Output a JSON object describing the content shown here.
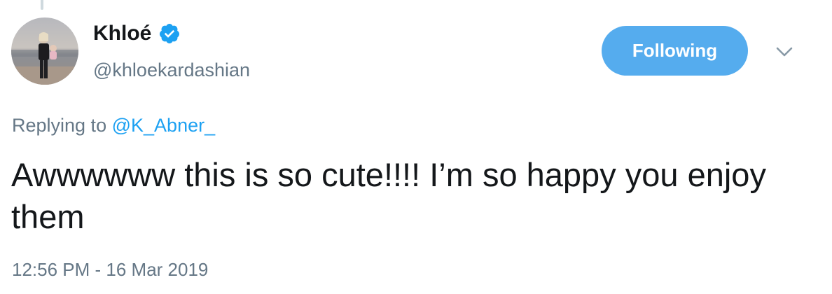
{
  "tweet": {
    "author": {
      "display_name": "Khloé",
      "handle": "@khloekardashian",
      "verified": true
    },
    "follow_button_label": "Following",
    "reply_context": {
      "prefix": "Replying to",
      "mention": "@K_Abner_"
    },
    "text": "Awwwwww this is so cute!!!! I’m so happy you enjoy them",
    "timestamp": "12:56 PM - 16 Mar 2019"
  },
  "colors": {
    "accent": "#1da1f2",
    "follow_button": "#55acee",
    "secondary_text": "#657786",
    "primary_text": "#14171a"
  },
  "icons": {
    "verified": "verified-badge-icon",
    "more": "chevron-down-icon"
  }
}
